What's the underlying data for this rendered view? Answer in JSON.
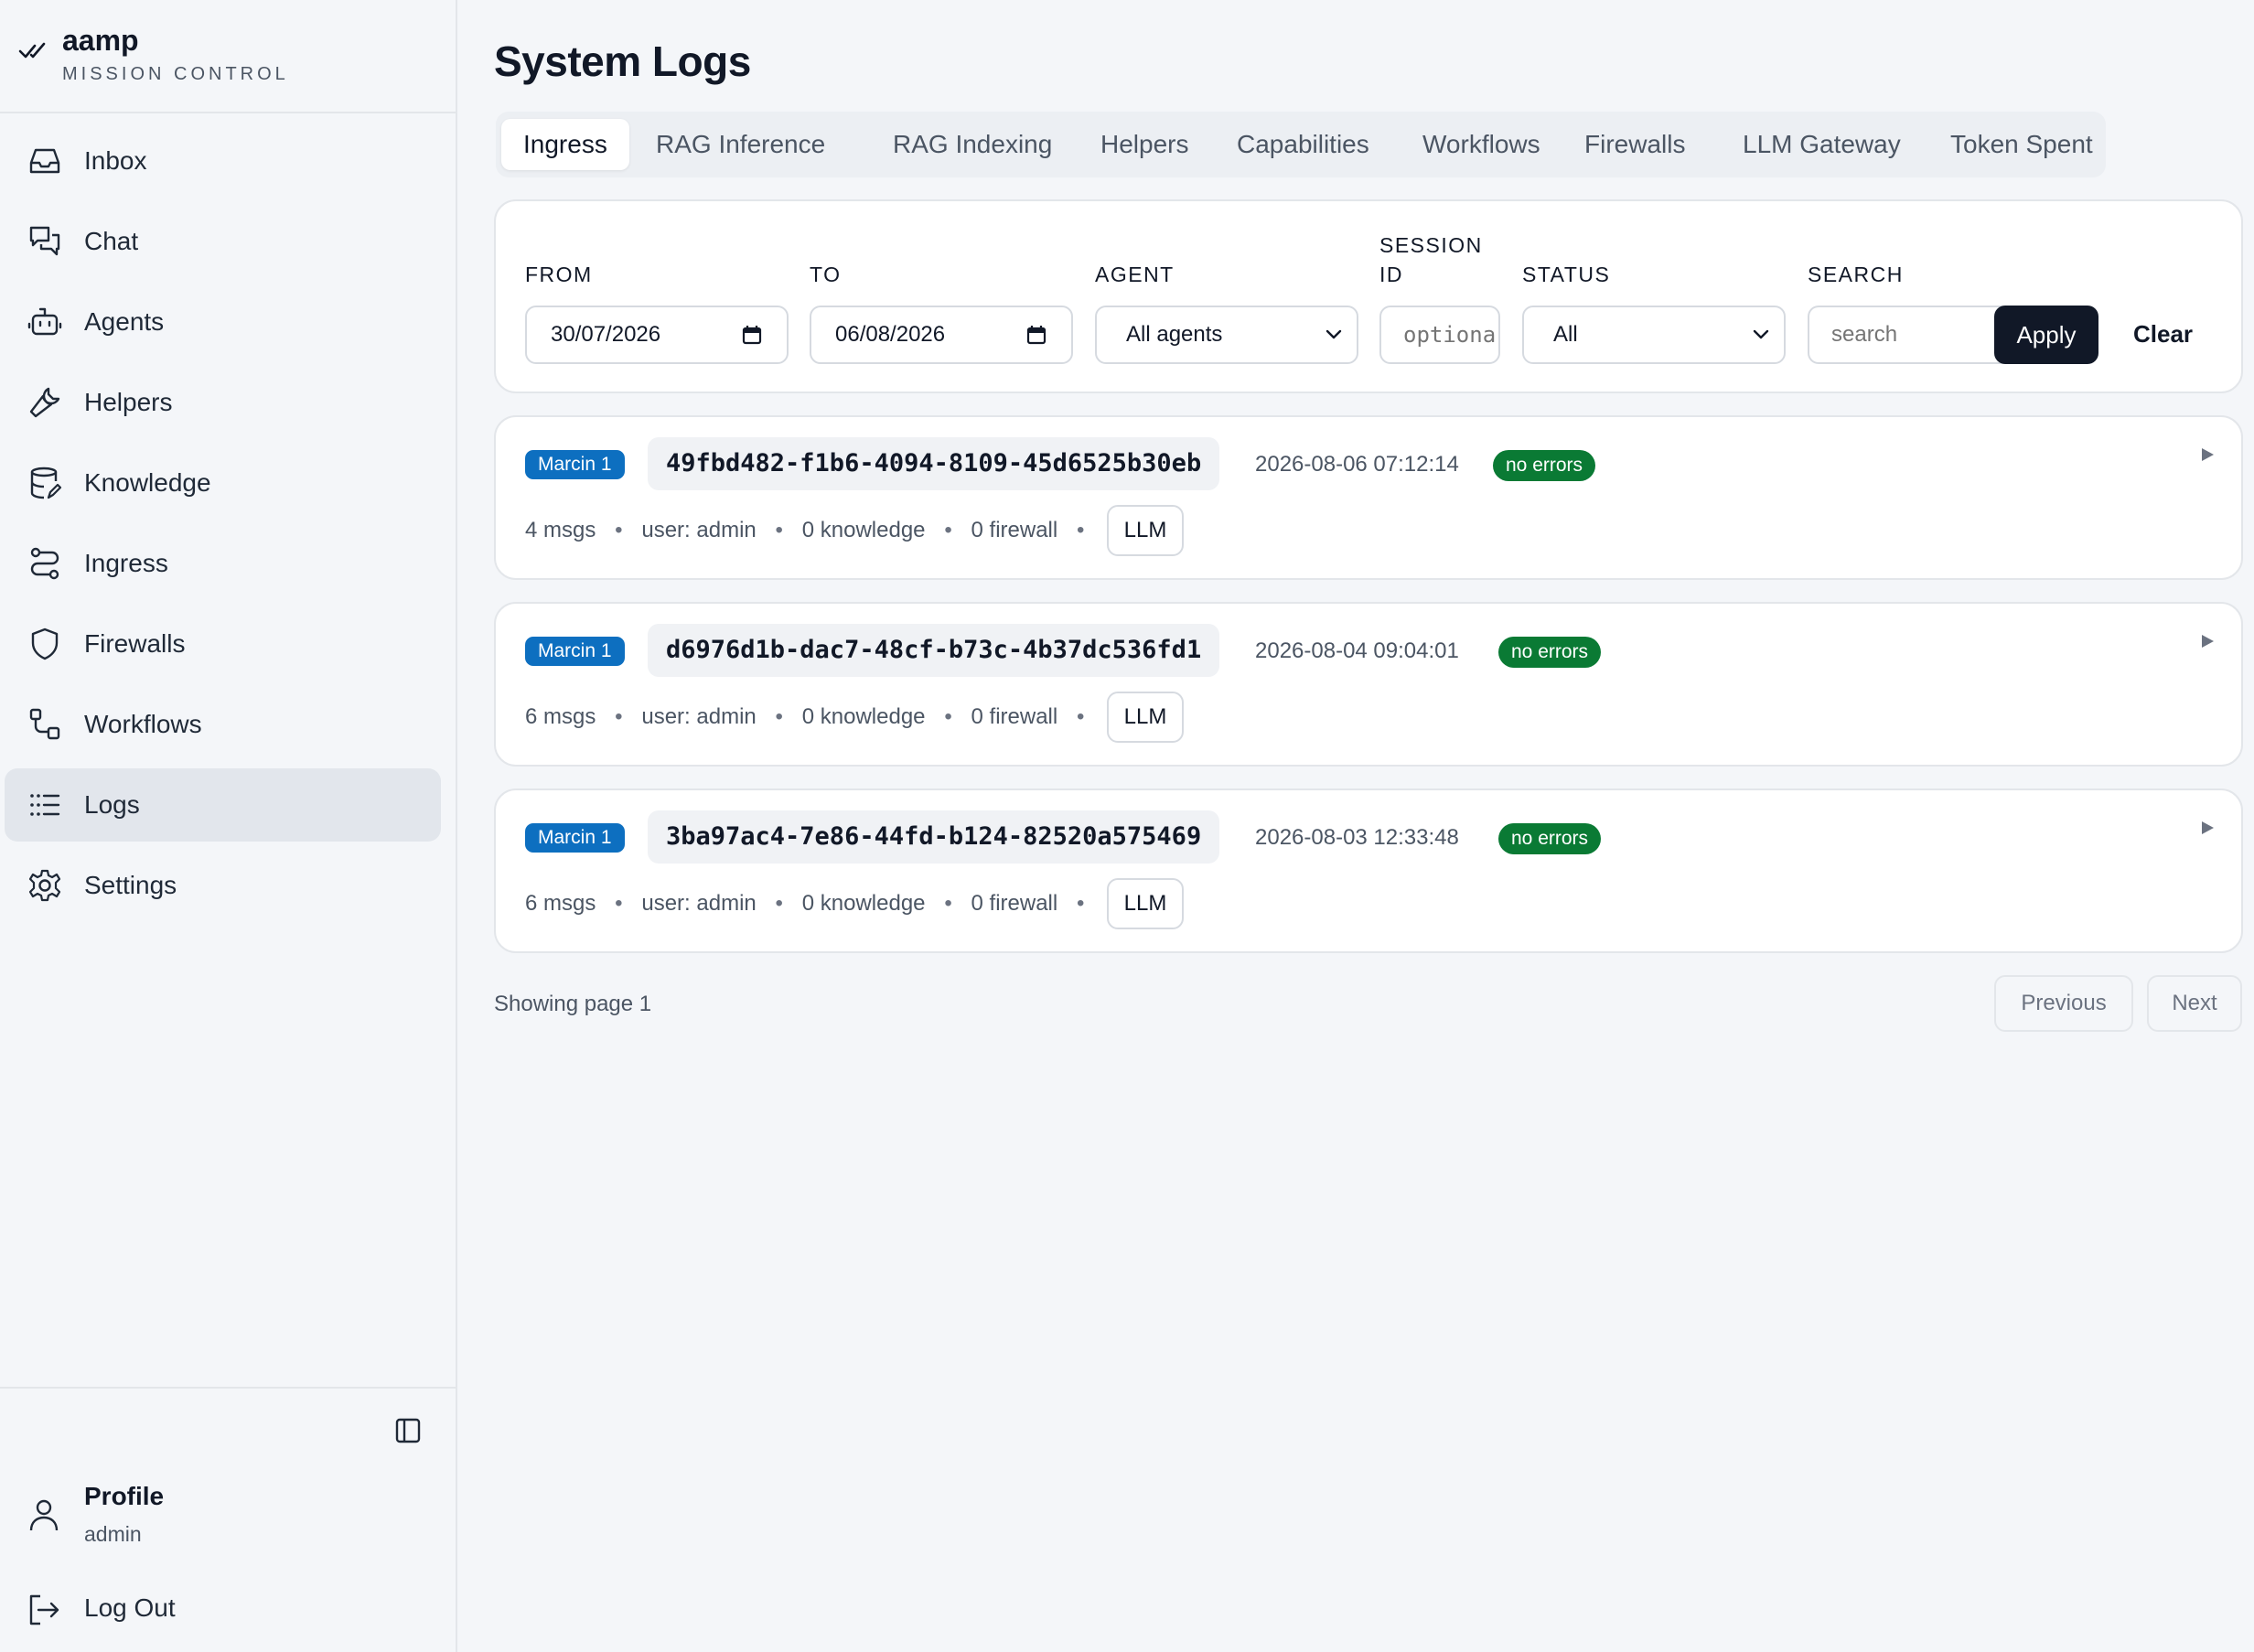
{
  "brand": {
    "name": "aamp",
    "subtitle": "MISSION CONTROL"
  },
  "sidebar": {
    "items": [
      {
        "label": "Inbox",
        "icon": "inbox-icon"
      },
      {
        "label": "Chat",
        "icon": "chat-icon"
      },
      {
        "label": "Agents",
        "icon": "robot-icon"
      },
      {
        "label": "Helpers",
        "icon": "wrench-icon"
      },
      {
        "label": "Knowledge",
        "icon": "database-icon"
      },
      {
        "label": "Ingress",
        "icon": "route-icon"
      },
      {
        "label": "Firewalls",
        "icon": "shield-icon"
      },
      {
        "label": "Workflows",
        "icon": "workflow-icon"
      },
      {
        "label": "Logs",
        "icon": "list-icon",
        "active": true
      },
      {
        "label": "Settings",
        "icon": "gear-icon"
      }
    ],
    "profile": {
      "title": "Profile",
      "user": "admin"
    },
    "logout": "Log Out"
  },
  "page": {
    "title": "System Logs"
  },
  "tabs": [
    {
      "label": "Ingress",
      "active": true
    },
    {
      "label": "RAG Inference"
    },
    {
      "label": "RAG Indexing"
    },
    {
      "label": "Helpers"
    },
    {
      "label": "Capabilities"
    },
    {
      "label": "Workflows"
    },
    {
      "label": "Firewalls"
    },
    {
      "label": "LLM Gateway"
    },
    {
      "label": "Token Spent"
    }
  ],
  "filters": {
    "from": {
      "label": "FROM",
      "value": "30/07/2026"
    },
    "to": {
      "label": "TO",
      "value": "06/08/2026"
    },
    "agent": {
      "label": "AGENT",
      "value": "All agents"
    },
    "session": {
      "label_line1": "SESSION",
      "label_line2": "ID",
      "placeholder": "optional"
    },
    "status": {
      "label": "STATUS",
      "value": "All"
    },
    "search": {
      "label": "SEARCH",
      "placeholder": "search"
    },
    "apply_label": "Apply",
    "clear_label": "Clear"
  },
  "logs": [
    {
      "agent": "Marcin 1",
      "session_id": "49fbd482-f1b6-4094-8109-45d6525b30eb",
      "timestamp": "2026-08-06 07:12:14",
      "status": "no errors",
      "msgs": "4 msgs",
      "user": "user: admin",
      "knowledge": "0 knowledge",
      "firewall": "0 firewall",
      "tag": "LLM"
    },
    {
      "agent": "Marcin 1",
      "session_id": "d6976d1b-dac7-48cf-b73c-4b37dc536fd1",
      "timestamp": "2026-08-04 09:04:01",
      "status": "no errors",
      "msgs": "6 msgs",
      "user": "user: admin",
      "knowledge": "0 knowledge",
      "firewall": "0 firewall",
      "tag": "LLM"
    },
    {
      "agent": "Marcin 1",
      "session_id": "3ba97ac4-7e86-44fd-b124-82520a575469",
      "timestamp": "2026-08-03 12:33:48",
      "status": "no errors",
      "msgs": "6 msgs",
      "user": "user: admin",
      "knowledge": "0 knowledge",
      "firewall": "0 firewall",
      "tag": "LLM"
    }
  ],
  "pagination": {
    "text": "Showing page 1",
    "previous": "Previous",
    "next": "Next"
  },
  "colors": {
    "accent": "#111827",
    "agent_badge": "#0d6fc0",
    "status_ok": "#0a7a34"
  }
}
